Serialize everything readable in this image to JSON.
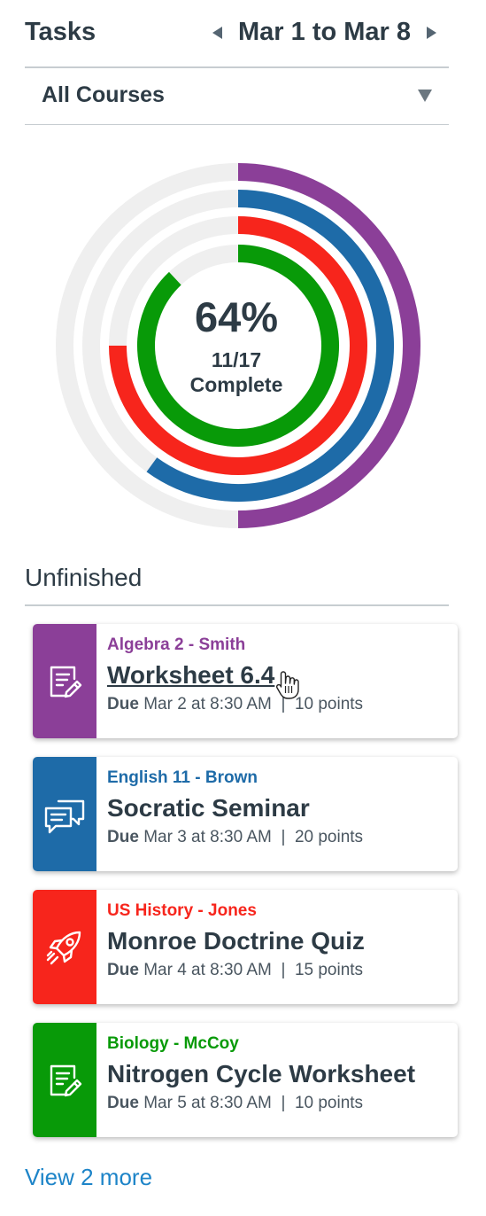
{
  "header": {
    "title": "Tasks",
    "date_range": "Mar 1 to Mar 8"
  },
  "filter": {
    "selected": "All Courses"
  },
  "progress": {
    "percent_label": "64%",
    "ratio_label": "11/17",
    "status_label": "Complete",
    "rings": [
      {
        "course": "Algebra 2 - Smith",
        "color": "#8b3f98",
        "fraction": 0.5
      },
      {
        "course": "English 11 - Brown",
        "color": "#1e6ba8",
        "fraction": 0.6
      },
      {
        "course": "US History - Jones",
        "color": "#f7251c",
        "fraction": 0.75
      },
      {
        "course": "Biology - McCoy",
        "color": "#089a08",
        "fraction": 0.88
      }
    ],
    "track_color": "#efefef"
  },
  "section": {
    "title": "Unfinished"
  },
  "tasks": [
    {
      "course": "Algebra 2 - Smith",
      "title": "Worksheet 6.4",
      "due_label": "Due",
      "due": "Mar 2 at 8:30 AM",
      "separator": "|",
      "points": "10 points",
      "color": "#8b3f98",
      "icon": "assignment-icon"
    },
    {
      "course": "English 11 - Brown",
      "title": "Socratic Seminar",
      "due_label": "Due",
      "due": "Mar 3 at 8:30 AM",
      "separator": "|",
      "points": "20 points",
      "color": "#1e6ba8",
      "icon": "discussion-icon"
    },
    {
      "course": "US History - Jones",
      "title": "Monroe Doctrine Quiz",
      "due_label": "Due",
      "due": "Mar 4 at 8:30 AM",
      "separator": "|",
      "points": "15 points",
      "color": "#f7251c",
      "icon": "quiz-rocket-icon"
    },
    {
      "course": "Biology - McCoy",
      "title": "Nitrogen Cycle Worksheet",
      "due_label": "Due",
      "due": "Mar 5 at 8:30 AM",
      "separator": "|",
      "points": "10 points",
      "color": "#089a08",
      "icon": "assignment-icon"
    }
  ],
  "footer": {
    "view_more": "View 2 more"
  }
}
